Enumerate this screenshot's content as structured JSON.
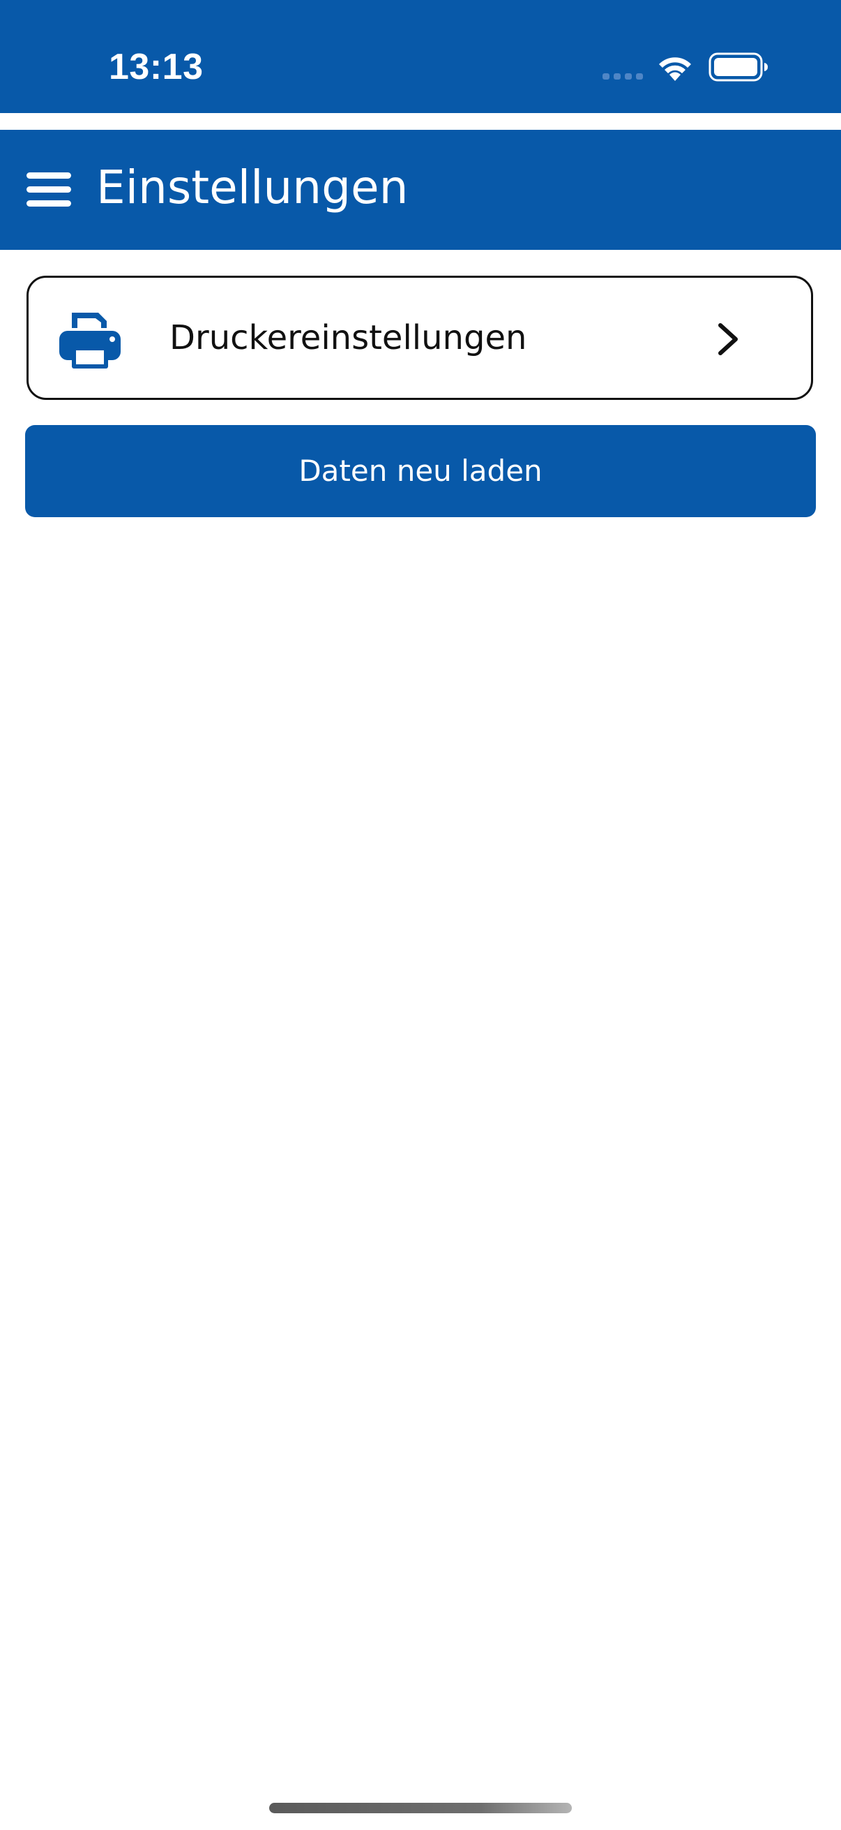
{
  "status_bar": {
    "time": "13:13"
  },
  "header": {
    "title": "Einstellungen",
    "menu_icon": "hamburger-menu-icon"
  },
  "settings": {
    "items": [
      {
        "label": "Druckereinstellungen",
        "icon": "printer-icon",
        "trailing_icon": "chevron-right-icon"
      }
    ]
  },
  "actions": {
    "reload_label": "Daten neu laden"
  },
  "colors": {
    "brand_blue": "#0859A9",
    "background": "#FFFFFF",
    "text_dark": "#111111"
  }
}
